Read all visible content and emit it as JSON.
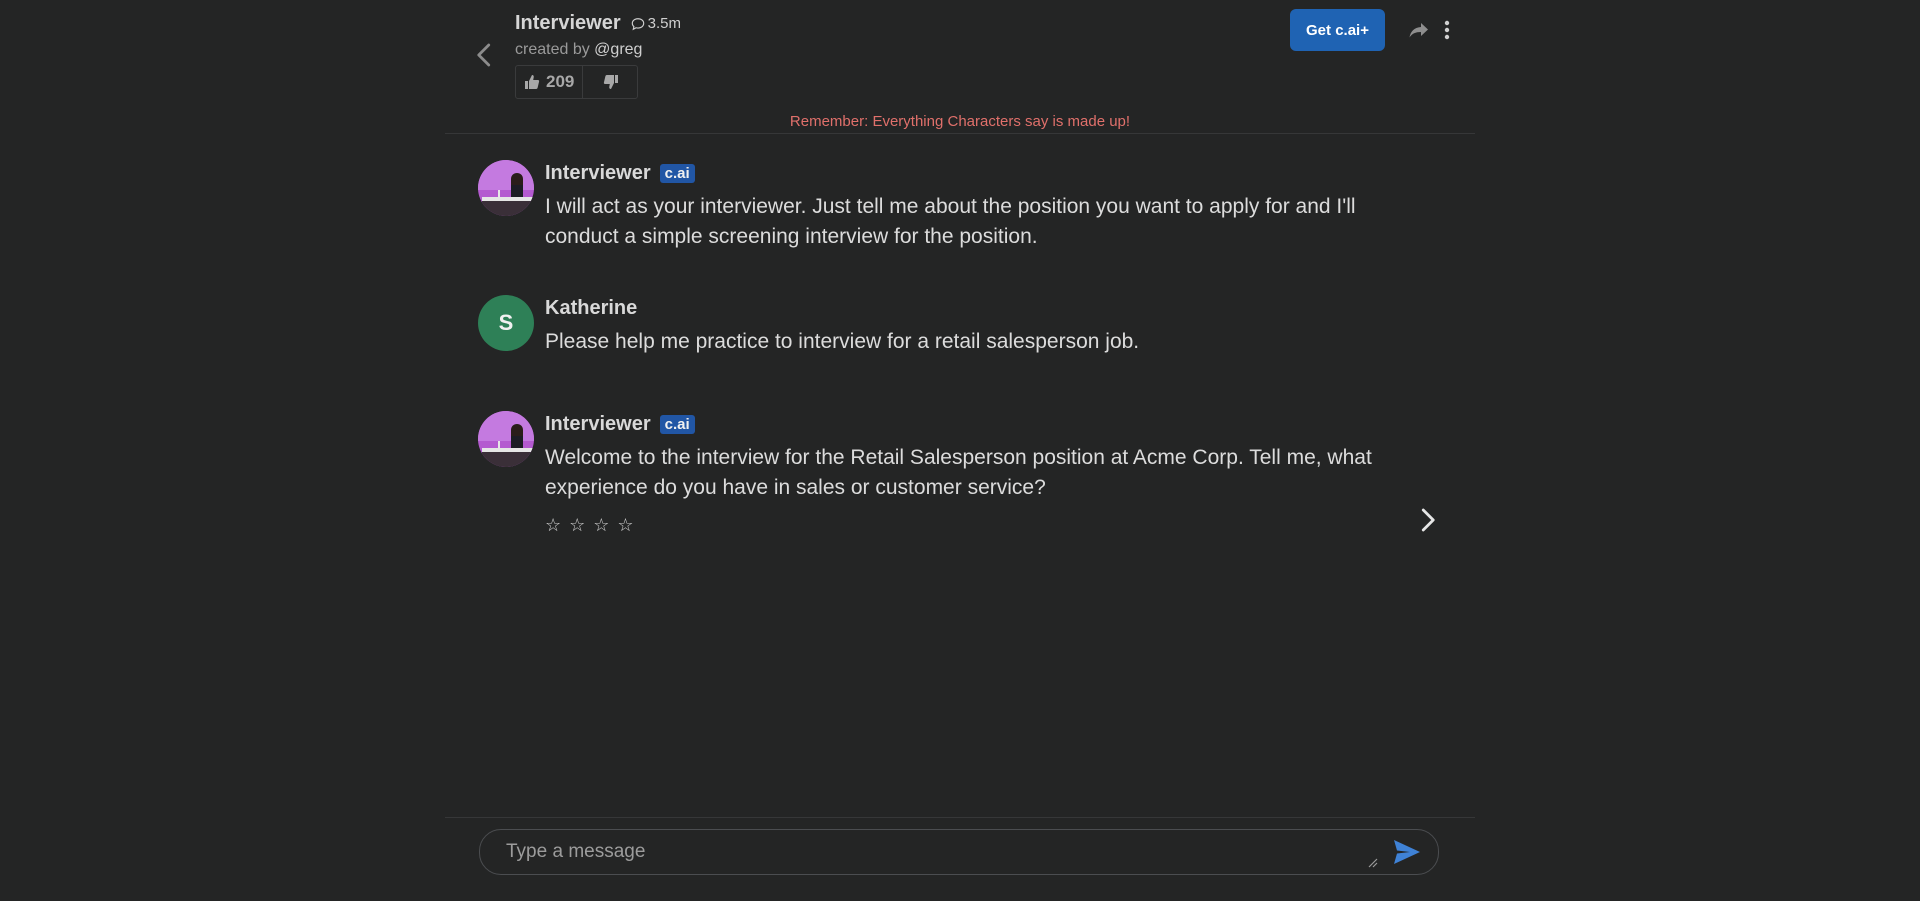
{
  "header": {
    "title": "Interviewer",
    "chat_count": "3.5m",
    "created_by_prefix": "created by",
    "creator_handle": "@greg",
    "likes": "209",
    "get_plus_label": "Get c.ai+",
    "warning": "Remember: Everything Characters say is made up!"
  },
  "messages": [
    {
      "sender": "Interviewer",
      "badge": "c.ai",
      "text": "I will act as your interviewer. Just tell me about the position you want to apply for and I'll conduct a simple screening interview for the position."
    },
    {
      "sender": "Katherine",
      "avatar_letter": "S",
      "text": "Please help me practice to interview for a retail salesperson job."
    },
    {
      "sender": "Interviewer",
      "badge": "c.ai",
      "text": "Welcome to the interview for the Retail Salesperson position at Acme Corp. Tell me, what experience do you have in sales or customer service?",
      "rating": {
        "stars": [
          "☆",
          "☆",
          "☆",
          "☆"
        ],
        "value": 0
      }
    }
  ],
  "composer": {
    "placeholder": "Type a message",
    "value": ""
  },
  "colors": {
    "background": "#242525",
    "accent": "#1f63b3",
    "badge": "#2156a5",
    "warning": "#e0706b",
    "user_avatar": "#2e8057",
    "send_icon": "#3f82d6"
  }
}
